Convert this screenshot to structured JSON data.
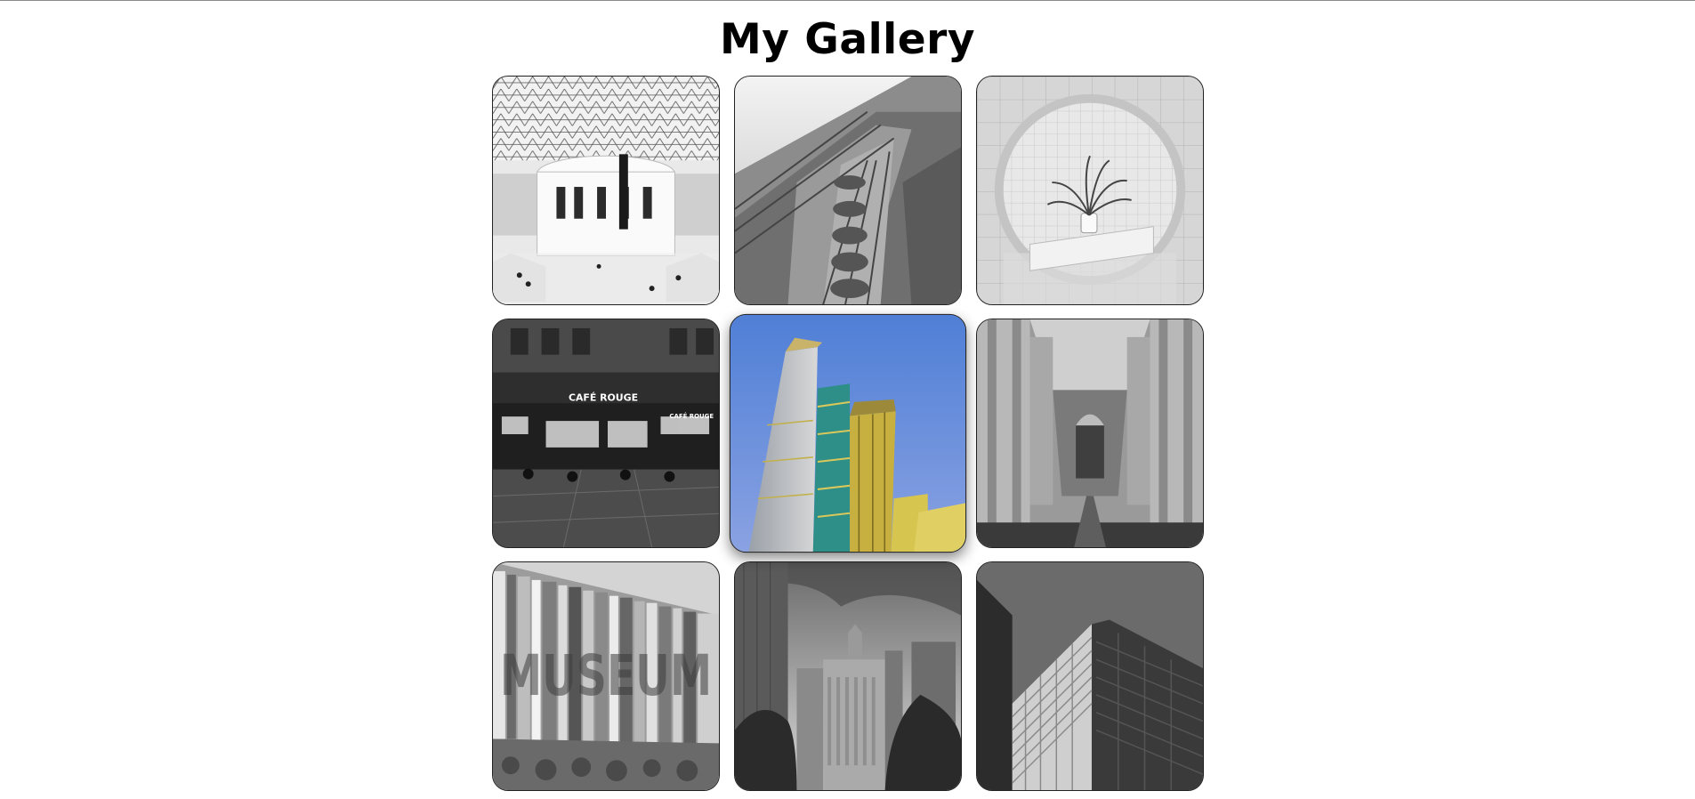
{
  "page": {
    "title": "My Gallery"
  },
  "gallery": {
    "active_index": 4,
    "images": [
      {
        "alt": "Library atrium with glass dome"
      },
      {
        "alt": "Ornate cathedral facade"
      },
      {
        "alt": "Tiled room with potted palm"
      },
      {
        "alt": "Corner cafe at night",
        "sign": "CAFÉ ROUGE",
        "sign2": "CAFÉ ROUGE"
      },
      {
        "alt": "Colorful glass skyscraper"
      },
      {
        "alt": "Cathedral nave interior"
      },
      {
        "alt": "Museum building facade",
        "sign": "MUSEUM"
      },
      {
        "alt": "City skyline with clouds"
      },
      {
        "alt": "Tall apartment tower"
      }
    ]
  }
}
